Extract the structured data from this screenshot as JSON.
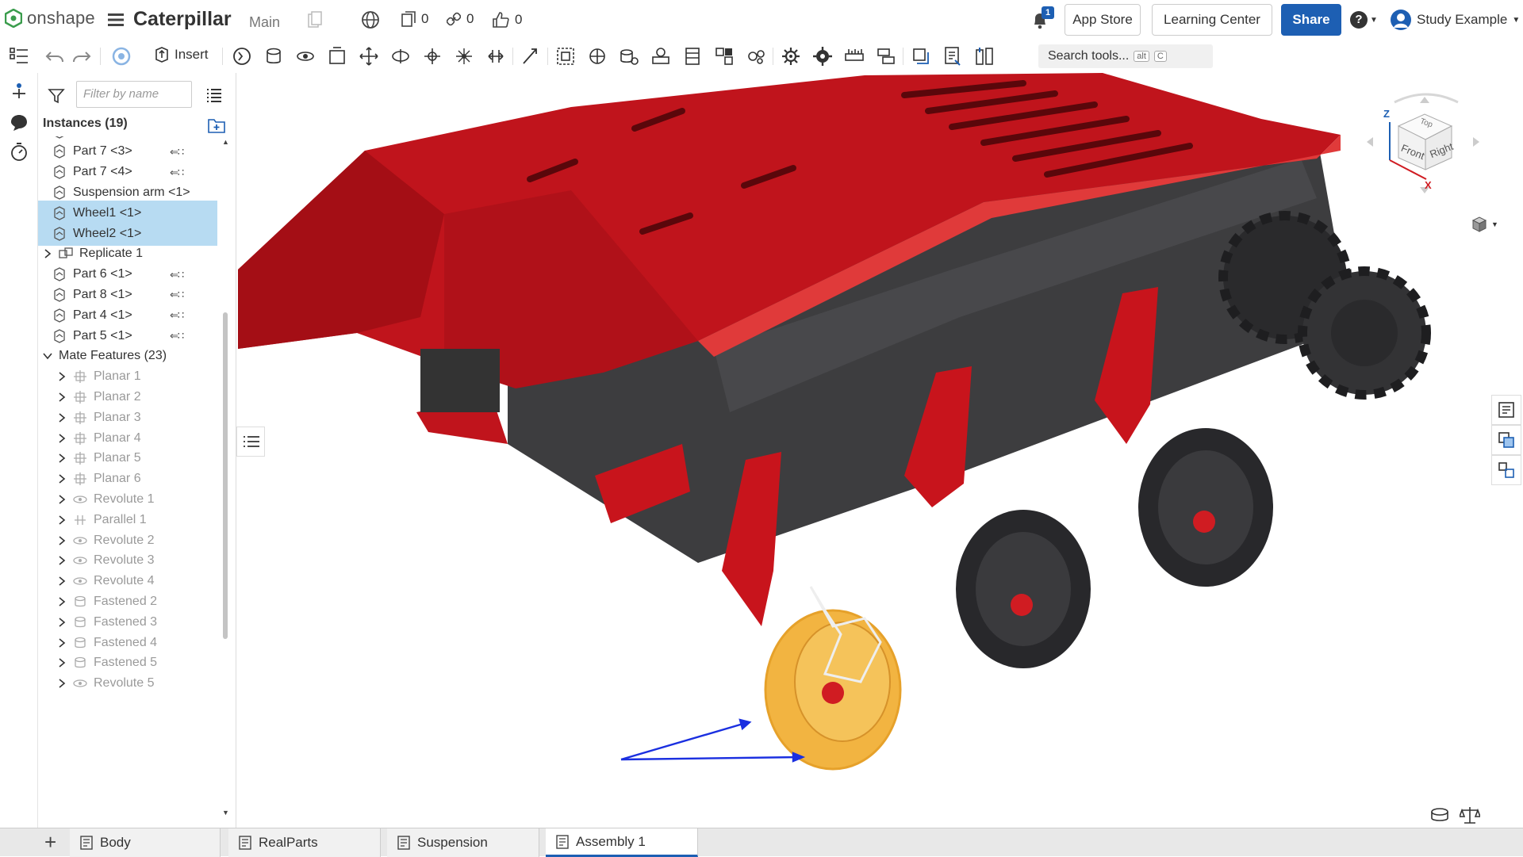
{
  "app": {
    "logo_text": "onshape"
  },
  "document": {
    "title": "Caterpillar",
    "branch": "Main"
  },
  "counts": {
    "versions": "0",
    "links": "0",
    "likes": "0"
  },
  "notifications": {
    "count": "1"
  },
  "header_buttons": {
    "app_store": "App Store",
    "learning_center": "Learning Center",
    "share": "Share",
    "help": "?",
    "user": "Study Example"
  },
  "toolbar": {
    "insert_label": "Insert",
    "search_label": "Search tools...",
    "search_shortcut_1": "alt",
    "search_shortcut_2": "C"
  },
  "panel": {
    "filter_placeholder": "Filter by name",
    "instances_header": "Instances (19)",
    "rows": [
      {
        "label": "Part 7 <2>",
        "kind": "part",
        "link": true,
        "selected": false,
        "dim": false
      },
      {
        "label": "Part 7 <3>",
        "kind": "part",
        "link": true,
        "selected": false,
        "dim": false
      },
      {
        "label": "Part 7 <4>",
        "kind": "part",
        "link": true,
        "selected": false,
        "dim": false
      },
      {
        "label": "Suspension arm <1>",
        "kind": "part",
        "link": false,
        "selected": false,
        "dim": false
      },
      {
        "label": "Wheel1 <1>",
        "kind": "part",
        "link": false,
        "selected": true,
        "dim": false
      },
      {
        "label": "Wheel2 <1>",
        "kind": "part",
        "link": false,
        "selected": true,
        "dim": false
      },
      {
        "label": "Replicate 1",
        "kind": "replicate",
        "link": false,
        "selected": false,
        "dim": false
      },
      {
        "label": "Part 6 <1>",
        "kind": "part",
        "link": true,
        "selected": false,
        "dim": false
      },
      {
        "label": "Part 8 <1>",
        "kind": "part",
        "link": true,
        "selected": false,
        "dim": false
      },
      {
        "label": "Part 4 <1>",
        "kind": "part",
        "link": true,
        "selected": false,
        "dim": false
      },
      {
        "label": "Part 5 <1>",
        "kind": "part",
        "link": true,
        "selected": false,
        "dim": false
      },
      {
        "label": "Mate Features (23)",
        "kind": "folder",
        "link": false,
        "selected": false,
        "dim": false
      },
      {
        "label": "Planar 1",
        "kind": "planar",
        "link": false,
        "selected": false,
        "dim": true
      },
      {
        "label": "Planar 2",
        "kind": "planar",
        "link": false,
        "selected": false,
        "dim": true
      },
      {
        "label": "Planar 3",
        "kind": "planar",
        "link": false,
        "selected": false,
        "dim": true
      },
      {
        "label": "Planar 4",
        "kind": "planar",
        "link": false,
        "selected": false,
        "dim": true
      },
      {
        "label": "Planar 5",
        "kind": "planar",
        "link": false,
        "selected": false,
        "dim": true
      },
      {
        "label": "Planar 6",
        "kind": "planar",
        "link": false,
        "selected": false,
        "dim": true
      },
      {
        "label": "Revolute 1",
        "kind": "revolute",
        "link": false,
        "selected": false,
        "dim": true
      },
      {
        "label": "Parallel 1",
        "kind": "parallel",
        "link": false,
        "selected": false,
        "dim": true
      },
      {
        "label": "Revolute 2",
        "kind": "revolute",
        "link": false,
        "selected": false,
        "dim": true
      },
      {
        "label": "Revolute 3",
        "kind": "revolute",
        "link": false,
        "selected": false,
        "dim": true
      },
      {
        "label": "Revolute 4",
        "kind": "revolute",
        "link": false,
        "selected": false,
        "dim": true
      },
      {
        "label": "Fastened 2",
        "kind": "fastened",
        "link": false,
        "selected": false,
        "dim": true
      },
      {
        "label": "Fastened 3",
        "kind": "fastened",
        "link": false,
        "selected": false,
        "dim": true
      },
      {
        "label": "Fastened 4",
        "kind": "fastened",
        "link": false,
        "selected": false,
        "dim": true
      },
      {
        "label": "Fastened 5",
        "kind": "fastened",
        "link": false,
        "selected": false,
        "dim": true
      },
      {
        "label": "Revolute 5",
        "kind": "revolute",
        "link": false,
        "selected": false,
        "dim": true
      }
    ]
  },
  "view_cube": {
    "top": "Top",
    "front": "Front",
    "right": "Right",
    "axis_z": "Z",
    "axis_x": "X"
  },
  "tabs": [
    {
      "label": "Body",
      "active": false
    },
    {
      "label": "RealParts",
      "active": false
    },
    {
      "label": "Suspension",
      "active": false
    },
    {
      "label": "Assembly 1",
      "active": true
    }
  ],
  "colors": {
    "accent": "#1d5fb3",
    "selection": "#b7dbf2",
    "body_red": "#c0141c",
    "body_dark": "#3d3d3f",
    "wheel_yellow": "#f2b441"
  }
}
